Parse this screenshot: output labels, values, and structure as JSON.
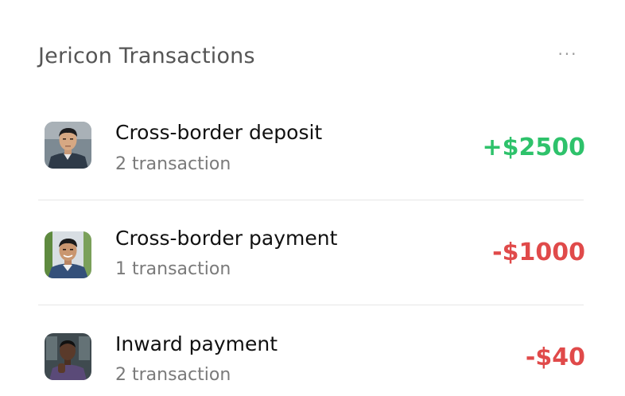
{
  "widget": {
    "title": "Jericon Transactions",
    "more_label": "···"
  },
  "colors": {
    "positive": "#2ec26b",
    "negative": "#e04a4a"
  },
  "transactions": [
    {
      "name": "Cross-border deposit",
      "count": "2 transaction",
      "amount": "+$2500",
      "direction": "positive",
      "avatar": "avatar-person-1"
    },
    {
      "name": "Cross-border payment",
      "count": "1 transaction",
      "amount": "-$1000",
      "direction": "negative",
      "avatar": "avatar-person-2"
    },
    {
      "name": "Inward payment",
      "count": "2 transaction",
      "amount": "-$40",
      "direction": "negative",
      "avatar": "avatar-person-3"
    }
  ]
}
